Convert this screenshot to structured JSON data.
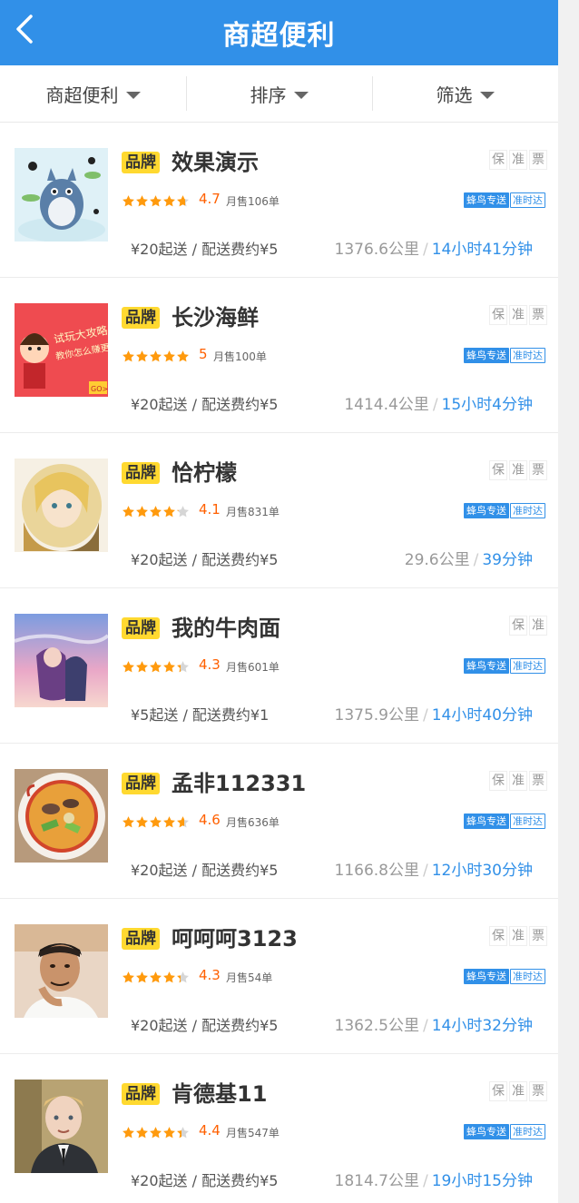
{
  "header": {
    "title": "商超便利",
    "back_icon": "chevron-left-icon"
  },
  "filters": [
    {
      "label": "商超便利"
    },
    {
      "label": "排序"
    },
    {
      "label": "筛选"
    }
  ],
  "brand_label": "品牌",
  "delivery_tags": {
    "primary": "蜂鸟专送",
    "secondary": "准时达"
  },
  "colors": {
    "accent": "#3190e8",
    "brand_tag": "#ffd930",
    "rating": "#ff6000",
    "star": "#ff9a0d"
  },
  "shops": [
    {
      "name": "效果演示",
      "guarantees": [
        "保",
        "准",
        "票"
      ],
      "rating": "4.7",
      "stars": 4.7,
      "monthly": "月售106单",
      "fee": "¥20起送 / 配送费约¥5",
      "distance": "1376.6公里",
      "eta": "14小时41分钟",
      "image": "totoro-illustration"
    },
    {
      "name": "长沙海鲜",
      "guarantees": [
        "保",
        "准",
        "票"
      ],
      "rating": "5",
      "stars": 5,
      "monthly": "月售100单",
      "fee": "¥20起送 / 配送费约¥5",
      "distance": "1414.4公里",
      "eta": "15小时4分钟",
      "image": "game-guide-banner"
    },
    {
      "name": "恰柠檬",
      "guarantees": [
        "保",
        "准",
        "票"
      ],
      "rating": "4.1",
      "stars": 4.1,
      "monthly": "月售831单",
      "fee": "¥20起送 / 配送费约¥5",
      "distance": "29.6公里",
      "eta": "39分钟",
      "image": "anime-blonde-girl"
    },
    {
      "name": "我的牛肉面",
      "guarantees": [
        "保",
        "准"
      ],
      "rating": "4.3",
      "stars": 4.3,
      "monthly": "月售601单",
      "fee": "¥5起送 / 配送费约¥1",
      "distance": "1375.9公里",
      "eta": "14小时40分钟",
      "image": "anime-sky-couple"
    },
    {
      "name": "孟非112331",
      "guarantees": [
        "保",
        "准",
        "票"
      ],
      "rating": "4.6",
      "stars": 4.6,
      "monthly": "月售636单",
      "fee": "¥20起送 / 配送费约¥5",
      "distance": "1166.8公里",
      "eta": "12小时30分钟",
      "image": "ramen-bowl"
    },
    {
      "name": "呵呵呵3123",
      "guarantees": [
        "保",
        "准",
        "票"
      ],
      "rating": "4.3",
      "stars": 4.3,
      "monthly": "月售54单",
      "fee": "¥20起送 / 配送费约¥5",
      "distance": "1362.5公里",
      "eta": "14小时32分钟",
      "image": "man-portrait"
    },
    {
      "name": "肯德基11",
      "guarantees": [
        "保",
        "准",
        "票"
      ],
      "rating": "4.4",
      "stars": 4.4,
      "monthly": "月售547单",
      "fee": "¥20起送 / 配送费约¥5",
      "distance": "1814.7公里",
      "eta": "19小时15分钟",
      "image": "boy-portrait"
    }
  ]
}
